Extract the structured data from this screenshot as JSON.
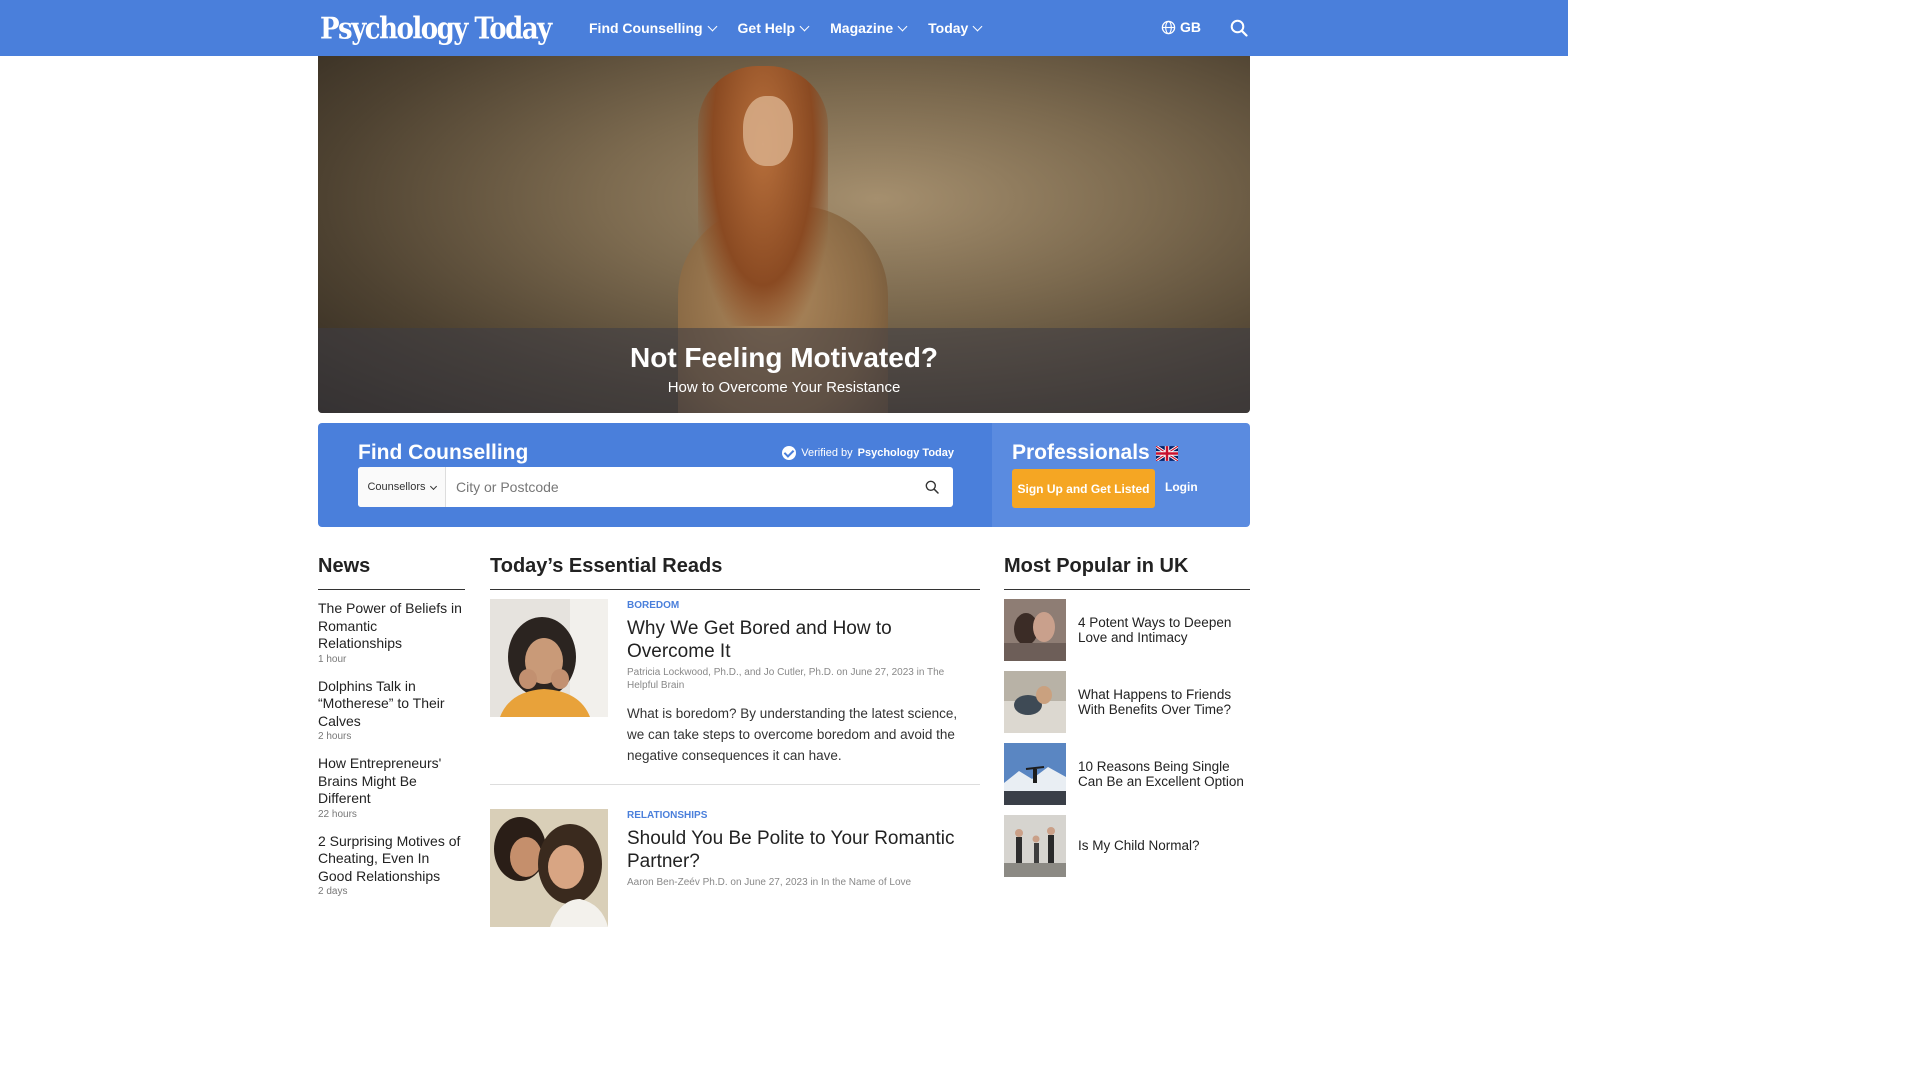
{
  "header": {
    "logo": "Psychology Today",
    "nav": [
      "Find Counselling",
      "Get Help",
      "Magazine",
      "Today"
    ],
    "region": "GB",
    "icons": {
      "globe": "globe-icon",
      "search": "search-icon"
    }
  },
  "hero": {
    "title": "Not Feeling Motivated?",
    "subtitle": "How to Overcome Your Resistance"
  },
  "find_counselling": {
    "title": "Find Counselling",
    "verified_prefix": "Verified by",
    "verified_brand": "Psychology Today",
    "select_value": "Counsellors",
    "input_placeholder": "City or Postcode"
  },
  "professionals": {
    "title": "Professionals",
    "signup_label": "Sign Up and Get Listed",
    "login_label": "Login"
  },
  "news": {
    "heading": "News",
    "items": [
      {
        "title": "The Power of Beliefs in Romantic Relationships",
        "time": "1 hour"
      },
      {
        "title": "Dolphins Talk in “Motherese” to Their Calves",
        "time": "2 hours"
      },
      {
        "title": "How Entrepreneurs' Brains Might Be Different",
        "time": "22 hours"
      },
      {
        "title": "2 Surprising Motives of Cheating, Even In Good Relationships",
        "time": "2 days"
      }
    ]
  },
  "essential_reads": {
    "heading": "Today’s Essential Reads",
    "articles": [
      {
        "tag": "BOREDOM",
        "title": "Why We Get Bored and How to Overcome It",
        "meta": "Patricia Lockwood, Ph.D., and Jo Cutler, Ph.D. on June 27, 2023 in The Helpful Brain",
        "desc": "What is boredom? By understanding the latest science, we can take steps to overcome boredom and avoid the negative consequences it can have."
      },
      {
        "tag": "RELATIONSHIPS",
        "title": "Should You Be Polite to Your Romantic Partner?",
        "meta": "Aaron Ben-Zeév Ph.D. on June 27, 2023 in In the Name of Love",
        "desc": ""
      }
    ]
  },
  "most_popular": {
    "heading": "Most Popular in UK",
    "items": [
      "4 Potent Ways to Deepen Love and Intimacy",
      "What Happens to Friends With Benefits Over Time?",
      "10 Reasons Being Single Can Be an Excellent Option",
      "Is My Child Normal?"
    ]
  }
}
